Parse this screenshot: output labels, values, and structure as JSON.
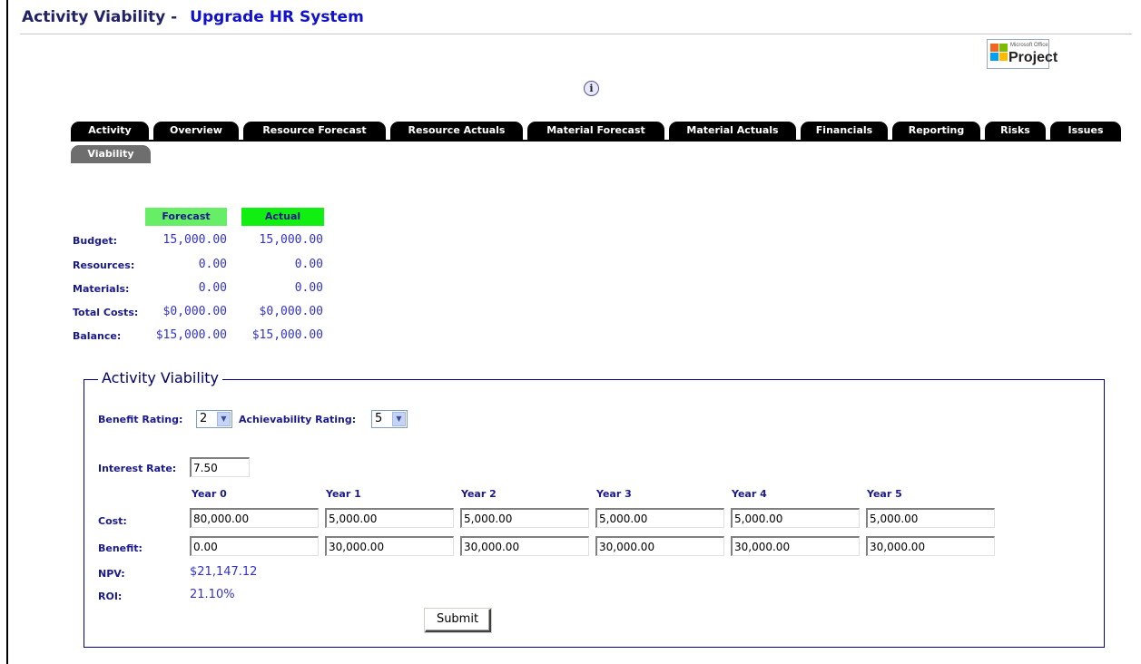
{
  "header": {
    "title_prefix": "Activity Viability -",
    "activity_name": "Upgrade HR System"
  },
  "logo": {
    "small_text": "Microsoft Office",
    "big_text": "Project"
  },
  "info_icon": {
    "glyph": "i"
  },
  "tabs": [
    {
      "label": "Activity"
    },
    {
      "label": "Overview"
    },
    {
      "label": "Resource Forecast"
    },
    {
      "label": "Resource Actuals"
    },
    {
      "label": "Material Forecast"
    },
    {
      "label": "Material Actuals"
    },
    {
      "label": "Financials"
    },
    {
      "label": "Reporting"
    },
    {
      "label": "Risks"
    },
    {
      "label": "Issues"
    },
    {
      "label": "Viability",
      "active": true
    }
  ],
  "summary": {
    "headers": {
      "forecast": "Forecast",
      "actual": "Actual"
    },
    "header_colors": {
      "forecast": "#66ee66",
      "actual": "#11ee11"
    },
    "rows": [
      {
        "label": "Budget:",
        "forecast": "15,000.00",
        "actual": "15,000.00"
      },
      {
        "label": "Resources:",
        "forecast": "0.00",
        "actual": "0.00"
      },
      {
        "label": "Materials:",
        "forecast": "0.00",
        "actual": "0.00"
      },
      {
        "label": "Total Costs:",
        "forecast": "$0,000.00",
        "actual": "$0,000.00"
      },
      {
        "label": "Balance:",
        "forecast": "$15,000.00",
        "actual": "$15,000.00"
      }
    ]
  },
  "viability": {
    "legend": "Activity Viability",
    "benefit_rating_label": "Benefit Rating:",
    "benefit_rating_value": "2",
    "achievability_rating_label": "Achievability Rating:",
    "achievability_rating_value": "5",
    "interest_rate_label": "Interest Rate:",
    "interest_rate_value": "7.50",
    "years": [
      "Year 0",
      "Year 1",
      "Year 2",
      "Year 3",
      "Year 4",
      "Year 5"
    ],
    "cost_label": "Cost:",
    "cost": [
      "80,000.00",
      "5,000.00",
      "5,000.00",
      "5,000.00",
      "5,000.00",
      "5,000.00"
    ],
    "benefit_label": "Benefit:",
    "benefit": [
      "0.00",
      "30,000.00",
      "30,000.00",
      "30,000.00",
      "30,000.00",
      "30,000.00"
    ],
    "npv_label": "NPV:",
    "npv_value": "$21,147.12",
    "roi_label": "ROI:",
    "roi_value": "21.10%",
    "submit_label": "Submit"
  }
}
